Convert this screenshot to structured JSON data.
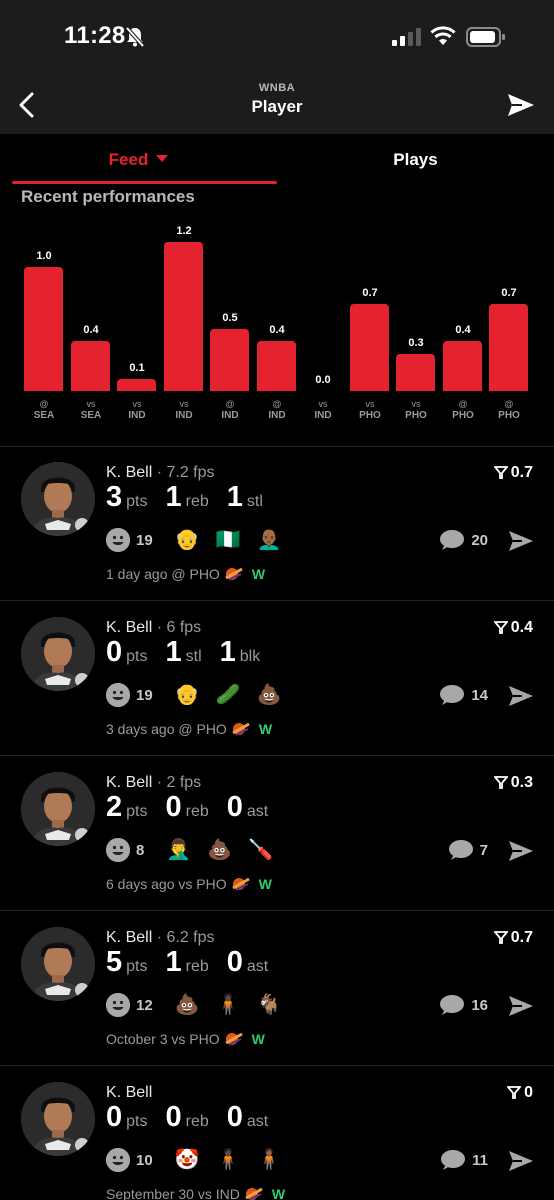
{
  "status_bar": {
    "time": "11:28"
  },
  "header": {
    "league": "WNBA",
    "title": "Player"
  },
  "tabs": [
    {
      "label": "Feed"
    },
    {
      "label": "Plays"
    }
  ],
  "section": {
    "title": "Recent performances"
  },
  "chart_data": {
    "type": "bar",
    "title": "Recent performances",
    "values": [
      1.0,
      0.4,
      0.1,
      1.2,
      0.5,
      0.4,
      0.0,
      0.7,
      0.3,
      0.4,
      0.7
    ],
    "value_labels": [
      "1.0",
      "0.4",
      "0.1",
      "1.2",
      "0.5",
      "0.4",
      "0.0",
      "0.7",
      "0.3",
      "0.4",
      "0.7"
    ],
    "categories": [
      {
        "prefix": "@",
        "team": "SEA"
      },
      {
        "prefix": "vs",
        "team": "SEA"
      },
      {
        "prefix": "vs",
        "team": "IND"
      },
      {
        "prefix": "vs",
        "team": "IND"
      },
      {
        "prefix": "@",
        "team": "IND"
      },
      {
        "prefix": "@",
        "team": "IND"
      },
      {
        "prefix": "vs",
        "team": "IND"
      },
      {
        "prefix": "vs",
        "team": "PHO"
      },
      {
        "prefix": "vs",
        "team": "PHO"
      },
      {
        "prefix": "@",
        "team": "PHO"
      },
      {
        "prefix": "@",
        "team": "PHO"
      }
    ],
    "ylim": [
      0,
      1.2
    ],
    "color": "#e5222f",
    "grid": false
  },
  "feed": [
    {
      "player": "K. Bell",
      "fps": "· 7.2 fps",
      "rating": "0.7",
      "stats": [
        {
          "value": "3",
          "unit": "pts"
        },
        {
          "value": "1",
          "unit": "reb"
        },
        {
          "value": "1",
          "unit": "stl"
        }
      ],
      "reaction_count": "19",
      "reactions": [
        "👴",
        "🇳🇬",
        "👨🏾‍🦲"
      ],
      "comment_count": "20",
      "meta": "1 day ago @ PHO",
      "result": "W"
    },
    {
      "player": "K. Bell",
      "fps": "· 6 fps",
      "rating": "0.4",
      "stats": [
        {
          "value": "0",
          "unit": "pts"
        },
        {
          "value": "1",
          "unit": "stl"
        },
        {
          "value": "1",
          "unit": "blk"
        }
      ],
      "reaction_count": "19",
      "reactions": [
        "👴",
        "🥒",
        "💩"
      ],
      "comment_count": "14",
      "meta": "3 days ago @ PHO",
      "result": "W"
    },
    {
      "player": "K. Bell",
      "fps": "· 2 fps",
      "rating": "0.3",
      "stats": [
        {
          "value": "2",
          "unit": "pts"
        },
        {
          "value": "0",
          "unit": "reb"
        },
        {
          "value": "0",
          "unit": "ast"
        }
      ],
      "reaction_count": "8",
      "reactions": [
        "🤦‍♂️",
        "💩",
        "🪛"
      ],
      "comment_count": "7",
      "meta": "6 days ago vs PHO",
      "result": "W"
    },
    {
      "player": "K. Bell",
      "fps": "· 6.2 fps",
      "rating": "0.7",
      "stats": [
        {
          "value": "5",
          "unit": "pts"
        },
        {
          "value": "1",
          "unit": "reb"
        },
        {
          "value": "0",
          "unit": "ast"
        }
      ],
      "reaction_count": "12",
      "reactions": [
        "💩",
        "🧍🏿",
        "🐐"
      ],
      "comment_count": "16",
      "meta": "October 3 vs PHO",
      "result": "W"
    },
    {
      "player": "K. Bell",
      "fps": "",
      "rating": "0",
      "stats": [
        {
          "value": "0",
          "unit": "pts"
        },
        {
          "value": "0",
          "unit": "reb"
        },
        {
          "value": "0",
          "unit": "ast"
        }
      ],
      "reaction_count": "10",
      "reactions": [
        "🤡",
        "🧍🏿",
        "🧍🏾"
      ],
      "comment_count": "11",
      "meta": "September 30 vs IND",
      "result": "W"
    }
  ]
}
